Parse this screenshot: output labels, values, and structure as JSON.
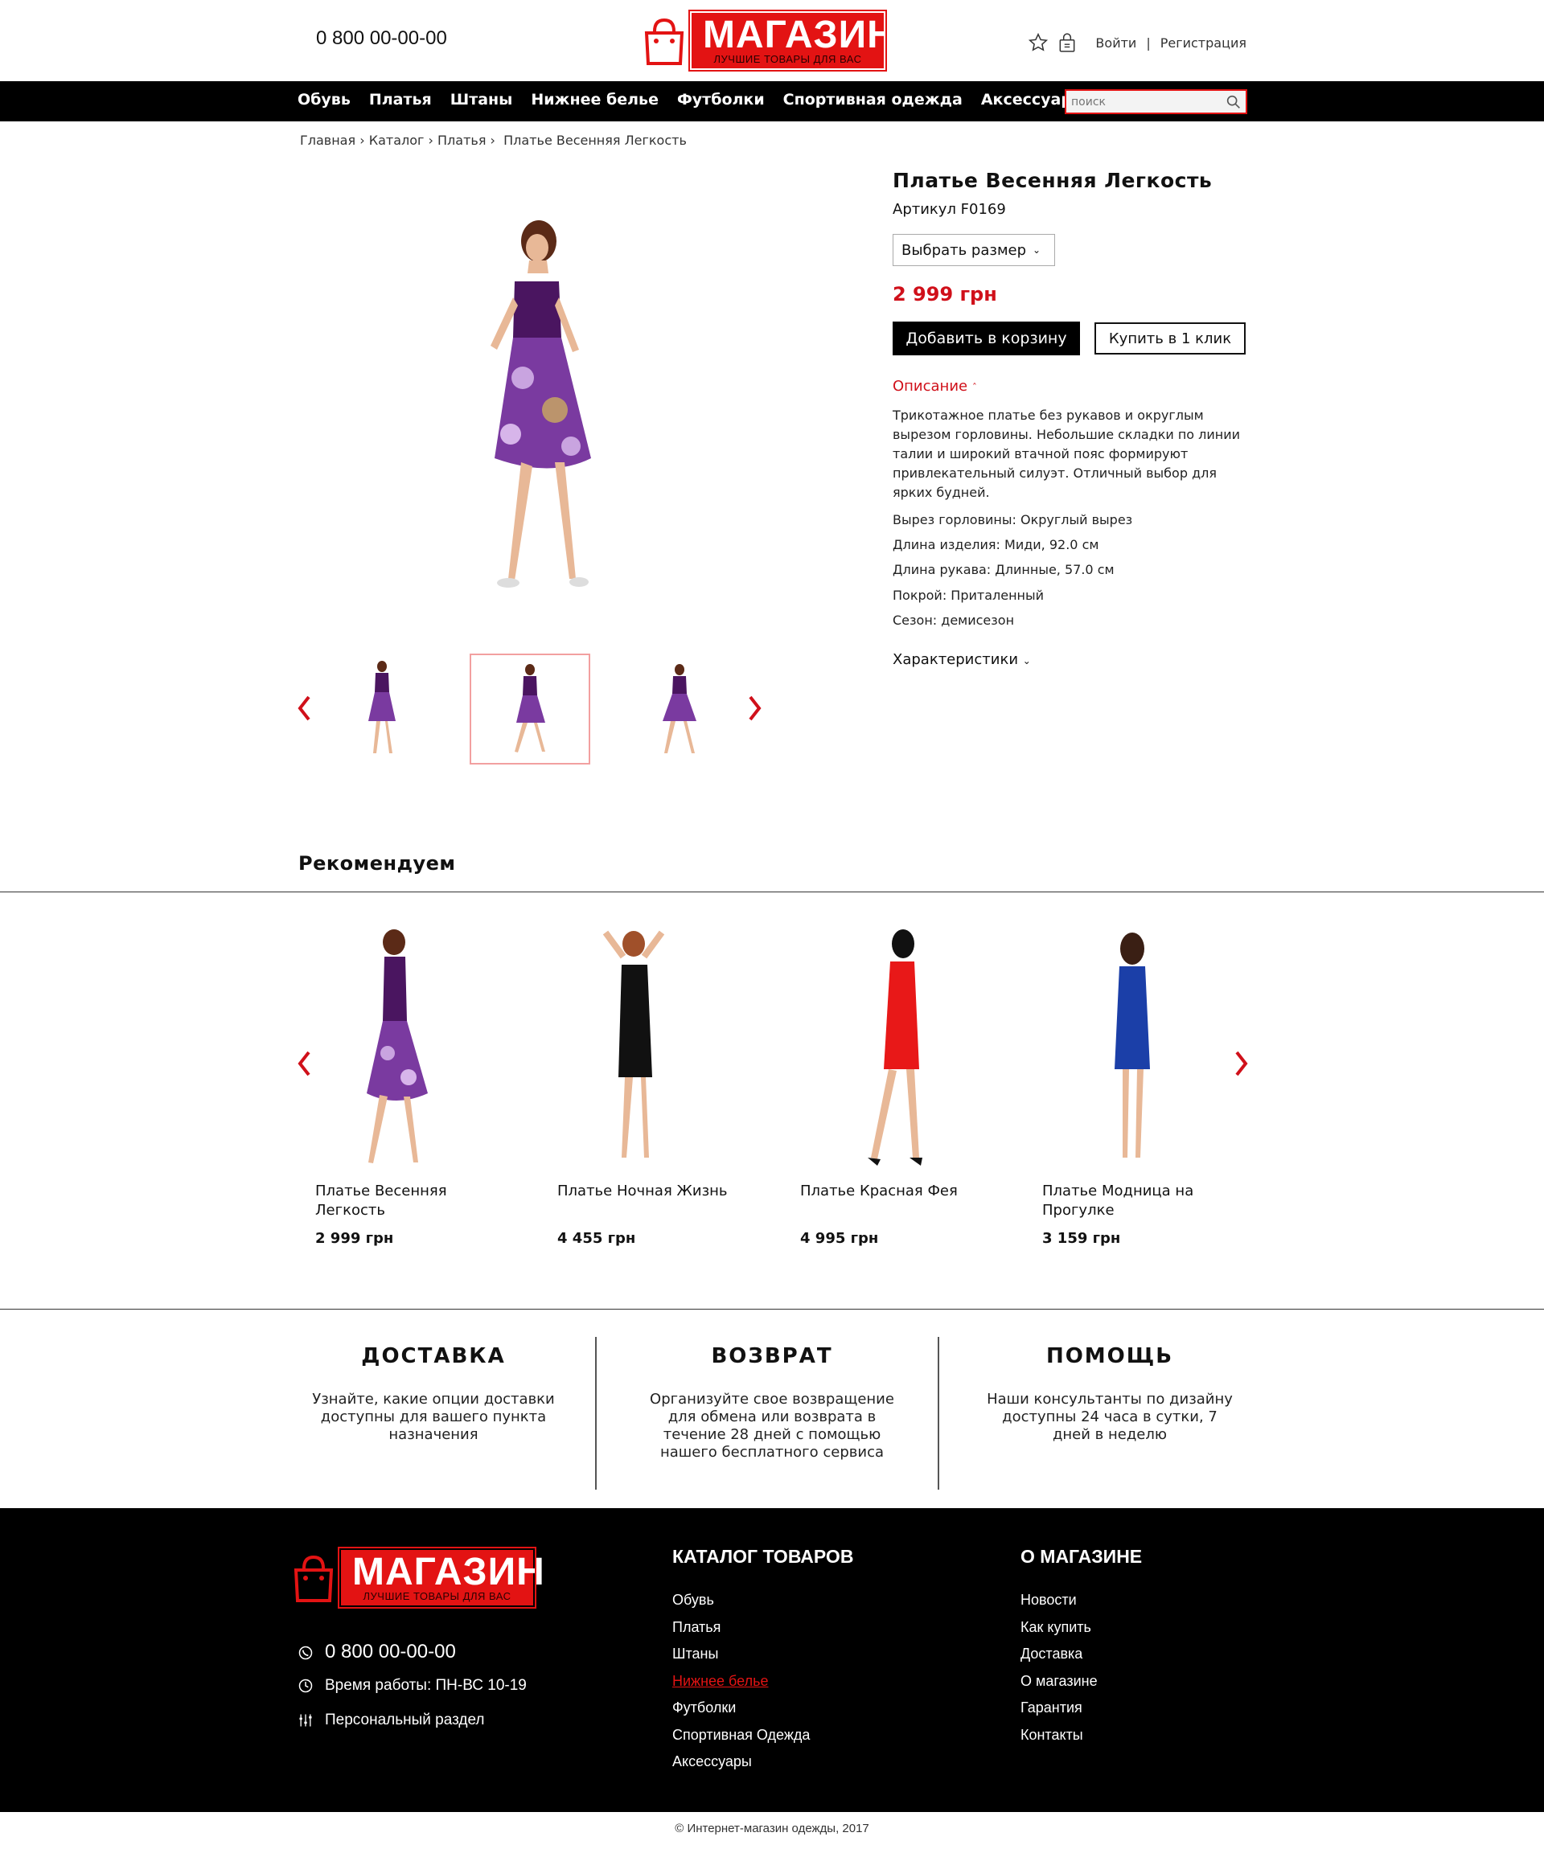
{
  "header": {
    "phone": "0 800 00-00-00",
    "logo_title": "МАГАЗИН",
    "logo_slogan": "ЛУЧШИЕ ТОВАРЫ ДЛЯ ВАС",
    "login": "Войти",
    "separator": "|",
    "register": "Регистрация"
  },
  "nav": {
    "items": [
      "Обувь",
      "Платья",
      "Штаны",
      "Нижнее белье",
      "Футболки",
      "Спортивная одежда",
      "Аксессуары"
    ],
    "dropdown_marker": "⌄",
    "search_placeholder": "поиск"
  },
  "breadcrumb": {
    "items": [
      "Главная",
      "Каталог",
      "Платья"
    ],
    "current": "Платье Весенняя Легкость",
    "sep": "›"
  },
  "product": {
    "title": "Платье Весенняя Легкость",
    "sku": "Артикул F0169",
    "size_select": "Выбрать размер",
    "price": "2 999 грн",
    "add_to_cart": "Добавить в корзину",
    "buy_one_click": "Купить в 1 клик",
    "description_label": "Описание",
    "description": "Трикотажное платье без рукавов и округлым вырезом горловины. Небольшие складки по линии талии и широкий втачной пояс формируют привлекательный силуэт. Отличный выбор для ярких будней.",
    "specs": [
      "Вырез горловины: Округлый вырез",
      "Длина изделия: Миди, 92.0 см",
      "Длина рукава: Длинные, 57.0 см",
      "Покрой: Приталенный",
      "Сезон: демисезон"
    ],
    "characteristics_label": "Характеристики"
  },
  "recommend": {
    "title": "Рекомендуем",
    "items": [
      {
        "name": "Платье Весенняя Легкость",
        "price": "2 999 грн",
        "dress_color": "#6a2a8c"
      },
      {
        "name": "Платье Ночная Жизнь",
        "price": "4 455 грн",
        "dress_color": "#111111"
      },
      {
        "name": "Платье Красная Фея",
        "price": "4 995 грн",
        "dress_color": "#e81818"
      },
      {
        "name": "Платье Модница на Прогулке",
        "price": "3 159 грн",
        "dress_color": "#1b3fa8"
      }
    ]
  },
  "info": {
    "delivery": {
      "title": "ДОСТАВКА",
      "text": "Узнайте, какие опции доставки доступны для вашего пункта назначения"
    },
    "return": {
      "title": "ВОЗВРАТ",
      "text": "Организуйте свое возвращение для обмена или возврата в течение 28 дней с помощью нашего бесплатного сервиса"
    },
    "help": {
      "title": "ПОМОЩЬ",
      "text": "Наши консультанты по дизайну доступны 24 часа в сутки, 7 дней в неделю"
    }
  },
  "footer": {
    "phone": "0 800 00-00-00",
    "hours": "Время работы: ПН-ВС 10-19",
    "personal": "Персональный раздел",
    "catalog_title": "КАТАЛОГ ТОВАРОВ",
    "catalog": [
      "Обувь",
      "Платья",
      "Штаны",
      "Нижнее белье",
      "Футболки",
      "Спортивная Одежда",
      "Аксессуары"
    ],
    "about_title": "О МАГАЗИНЕ",
    "about": [
      "Новости",
      "Как купить",
      "Доставка",
      "О магазине",
      "Гарантия",
      "Контакты"
    ]
  },
  "copyright": "© Интернет-магазин одежды, 2017",
  "colors": {
    "accent": "#e31313",
    "price": "#d0101a",
    "dark": "#000000"
  }
}
